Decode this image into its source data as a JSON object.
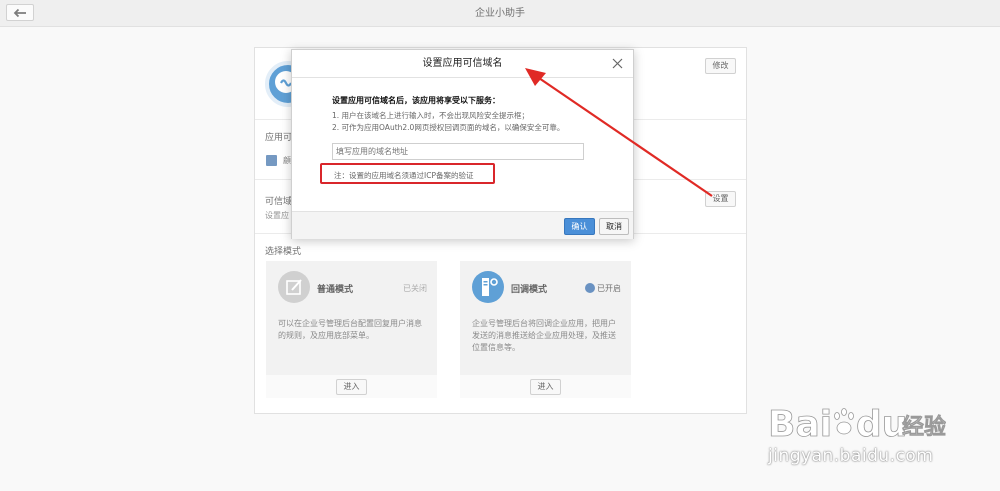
{
  "topbar": {
    "title": "企业小助手",
    "back_icon": "arrow-left-icon"
  },
  "panel": {
    "edit_label": "修改",
    "sections": {
      "visible_range_title": "应用可",
      "visible_item": "顧",
      "trusted_domain_title": "可信域",
      "trusted_domain_desc": "设置应",
      "set_label": "设置",
      "mode_title": "选择模式"
    },
    "modes": [
      {
        "name": "普通模式",
        "status": "已关闭",
        "description": "可以在企业号管理后台配置回复用户消息的规则，及应用底部菜单。",
        "enter_label": "进入",
        "icon": "edit-icon"
      },
      {
        "name": "回调模式",
        "status": "已开启",
        "description": "企业号管理后台将回调企业应用，把用户发送的消息推送给企业应用处理，及推送位置信息等。",
        "enter_label": "进入",
        "icon": "server-gear-icon"
      }
    ]
  },
  "modal": {
    "title": "设置应用可信域名",
    "intro_title": "设置应用可信域名后，该应用将享受以下服务：",
    "intro_items": [
      "1. 用户在该域名上进行输入时，不会出现风险安全提示框；",
      "2. 可作为应用OAuth2.0网页授权回调页面的域名，以确保安全可靠。"
    ],
    "input_value": "",
    "input_placeholder": "填写应用的域名地址",
    "note": "注：设置的应用域名须通过ICP备案的验证",
    "confirm_label": "确认",
    "cancel_label": "取消"
  },
  "watermark": {
    "logo_text": "Baidu经验",
    "url": "jingyan.baidu.com"
  },
  "colors": {
    "accent": "#4a8fd8",
    "highlight": "#d9262b",
    "brand": "#1b78c4"
  }
}
